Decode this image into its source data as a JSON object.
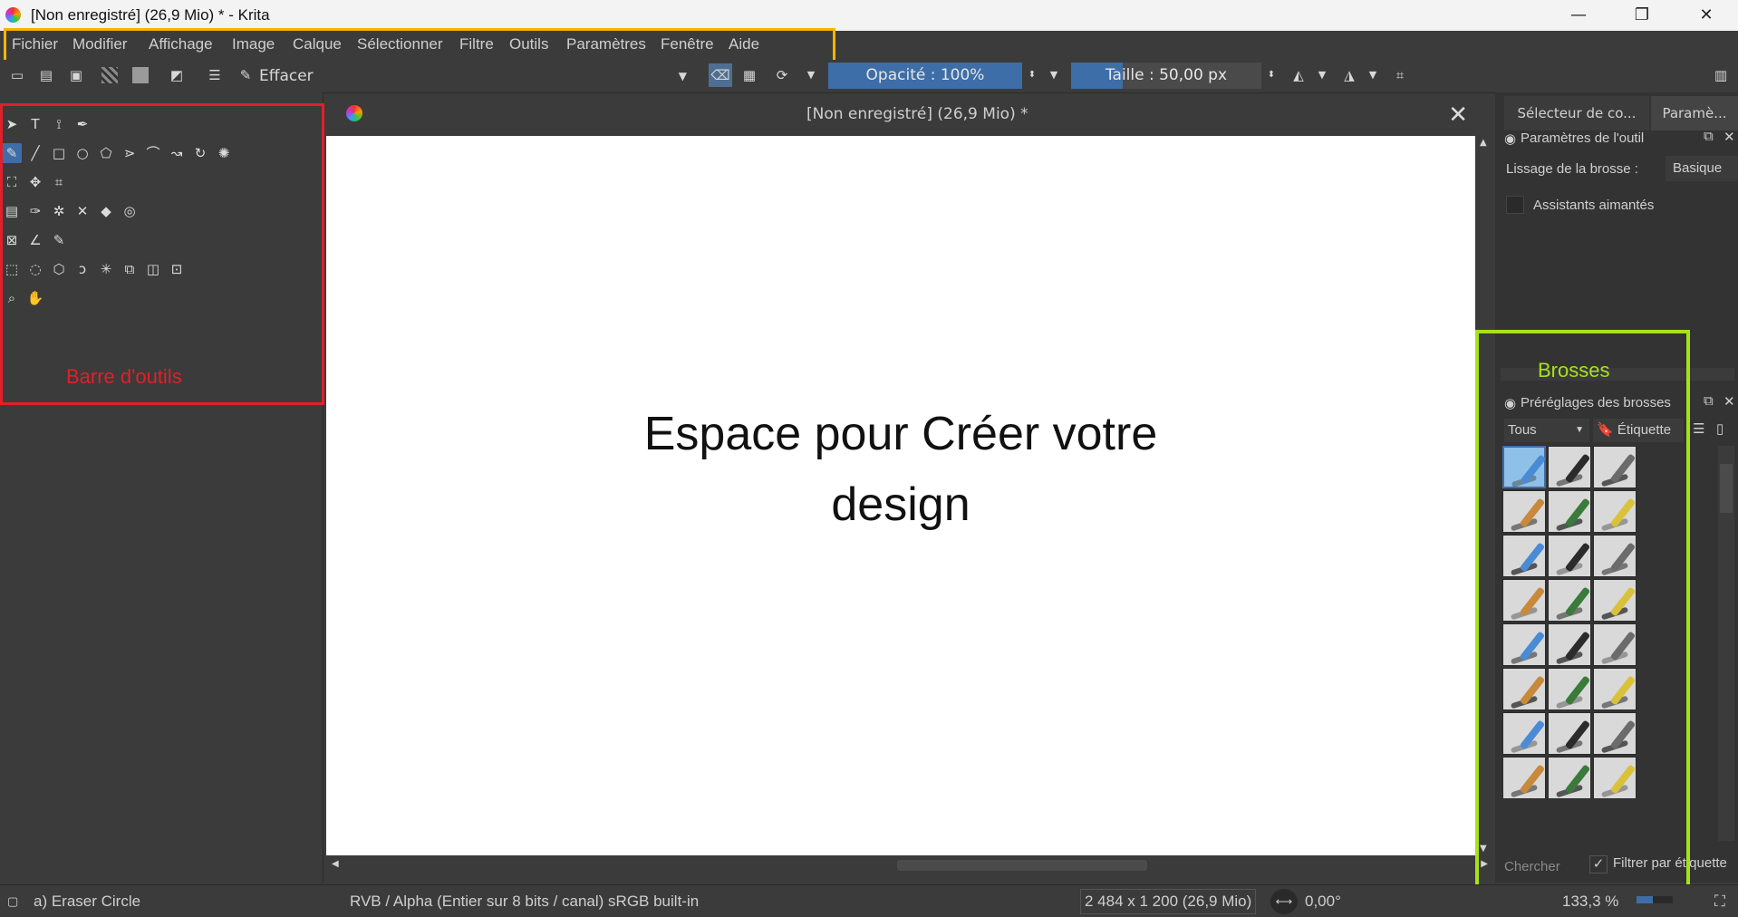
{
  "window": {
    "title": "[Non enregistré]  (26,9 Mio) * - Krita"
  },
  "menu": [
    "Fichier",
    "Modifier",
    "Affichage",
    "Image",
    "Calque",
    "Sélectionner",
    "Filtre",
    "Outils",
    "Paramètres",
    "Fenêtre",
    "Aide"
  ],
  "toolbar": {
    "brush_preset": "Effacer",
    "opacity_label": "Opacité : 100%",
    "opacity_value": 1.0,
    "size_label": "Taille :  50,00 px",
    "size_fill": 0.27
  },
  "annotations": {
    "tools": "Barre d'outils",
    "brushes": "Brosses"
  },
  "document": {
    "tab_title": "[Non enregistré]  (26,9 Mio) *",
    "canvas_line1": "Espace pour Créer votre",
    "canvas_line2": "design"
  },
  "right_panel": {
    "tab1": "Sélecteur de co...",
    "tab2": "Paramè...",
    "tool_options_title": "Paramètres de l'outil",
    "smoothing_label": "Lissage de la brosse :",
    "smoothing_value": "Basique",
    "assistants_label": "Assistants aimantés",
    "presets_title": "Préréglages des brosses",
    "filter_all": "Tous",
    "tag_label": "Étiquette",
    "search_placeholder": "Chercher",
    "filter_by_tag": "Filtrer par étiquette"
  },
  "status": {
    "brush": "a) Eraser Circle",
    "colorspace": "RVB / Alpha (Entier sur 8 bits / canal)  sRGB built-in",
    "image_size": "2 484 x 1 200 (26,9 Mio)",
    "rotation": "0,00°",
    "zoom": "133,3 %"
  },
  "colors": {
    "accent": "#3d6ea8",
    "menu_highlight": "#f5b400",
    "tools_highlight": "#e0202a",
    "brushes_highlight": "#a6e21b"
  }
}
